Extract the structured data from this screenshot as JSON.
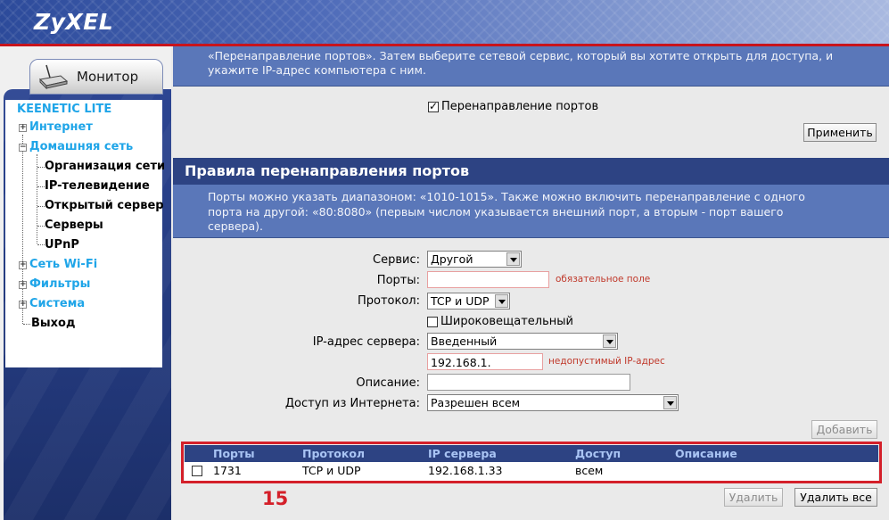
{
  "header": {
    "logo": "ZyXEL"
  },
  "sidebar": {
    "tab_label": "Монитор",
    "product": "KEENETIC LITE",
    "items": [
      {
        "label": "Интернет",
        "expanded": false
      },
      {
        "label": "Домашняя сеть",
        "expanded": true
      },
      {
        "label": "Сеть Wi-Fi",
        "expanded": false
      },
      {
        "label": "Фильтры",
        "expanded": false
      },
      {
        "label": "Система",
        "expanded": false
      },
      {
        "label": "Выход"
      }
    ],
    "subitems": [
      "Организация сети",
      "IP-телевидение",
      "Открытый сервер",
      "Серверы",
      "UPnP"
    ]
  },
  "top_info": {
    "line1": "«Перенаправление портов». Затем выберите сетевой сервис, который вы хотите открыть для доступа, и",
    "line2": "укажите IP-адрес компьютера с ним."
  },
  "port_forwarding": {
    "checkbox_label": "Перенаправление портов",
    "checked": true,
    "apply_label": "Применить"
  },
  "rules": {
    "title": "Правила перенаправления портов",
    "info_line1": "Порты можно указать диапазоном: «1010-1015». Также можно включить перенаправление с одного",
    "info_line2": "порта на другой: «80:8080» (первым числом указывается внешний порт, а вторым - порт вашего",
    "info_line3": "сервера).",
    "form": {
      "service_label": "Сервис:",
      "service_value": "Другой",
      "ports_label": "Порты:",
      "ports_value": "",
      "ports_error": "обязательное поле",
      "protocol_label": "Протокол:",
      "protocol_value": "TCP и UDP",
      "broadcast_label": "Широковещательный",
      "broadcast_checked": false,
      "ip_label": "IP-адрес сервера:",
      "ip_mode": "Введенный",
      "ip_value": "192.168.1.",
      "ip_error": "недопустимый IP-адрес",
      "description_label": "Описание:",
      "description_value": "",
      "access_label": "Доступ из Интернета:",
      "access_value": "Разрешен всем"
    },
    "add_label": "Добавить",
    "table": {
      "headers": [
        "Порты",
        "Протокол",
        "IP сервера",
        "Доступ",
        "Описание"
      ],
      "rows": [
        {
          "ports": "1731",
          "protocol": "TCP и UDP",
          "ip": "192.168.1.33",
          "access": "всем",
          "description": ""
        }
      ]
    },
    "delete_label": "Удалить",
    "delete_all_label": "Удалить все"
  },
  "annotation": {
    "step": "15"
  },
  "colors": {
    "header_blue": "#2c4a9a",
    "accent_red": "#c8141c",
    "nav_cyan": "#1fa5e8",
    "section_navy": "#2d4383"
  }
}
